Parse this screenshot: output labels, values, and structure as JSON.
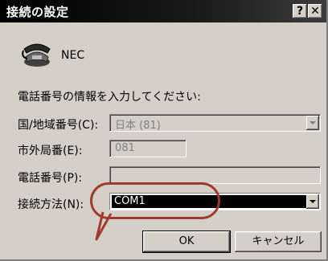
{
  "window": {
    "title": "接続の設定",
    "help_glyph": "?",
    "close_glyph": "✕"
  },
  "connection_name": "NEC",
  "instruction": "電話番号の情報を入力してください:",
  "fields": {
    "country_label": "国/地域番号(C):",
    "country_value": "日本 (81)",
    "area_label": "市外局番(E):",
    "area_value": "081",
    "phone_label": "電話番号(P):",
    "phone_value": "",
    "connect_label": "接続方法(N):",
    "connect_value": "COM1"
  },
  "buttons": {
    "ok": "OK",
    "cancel": "キャンセル"
  },
  "colors": {
    "highlight_ring": "#a0392f",
    "dialog_face": "#d4d0c8",
    "titlebar": "#000000"
  }
}
